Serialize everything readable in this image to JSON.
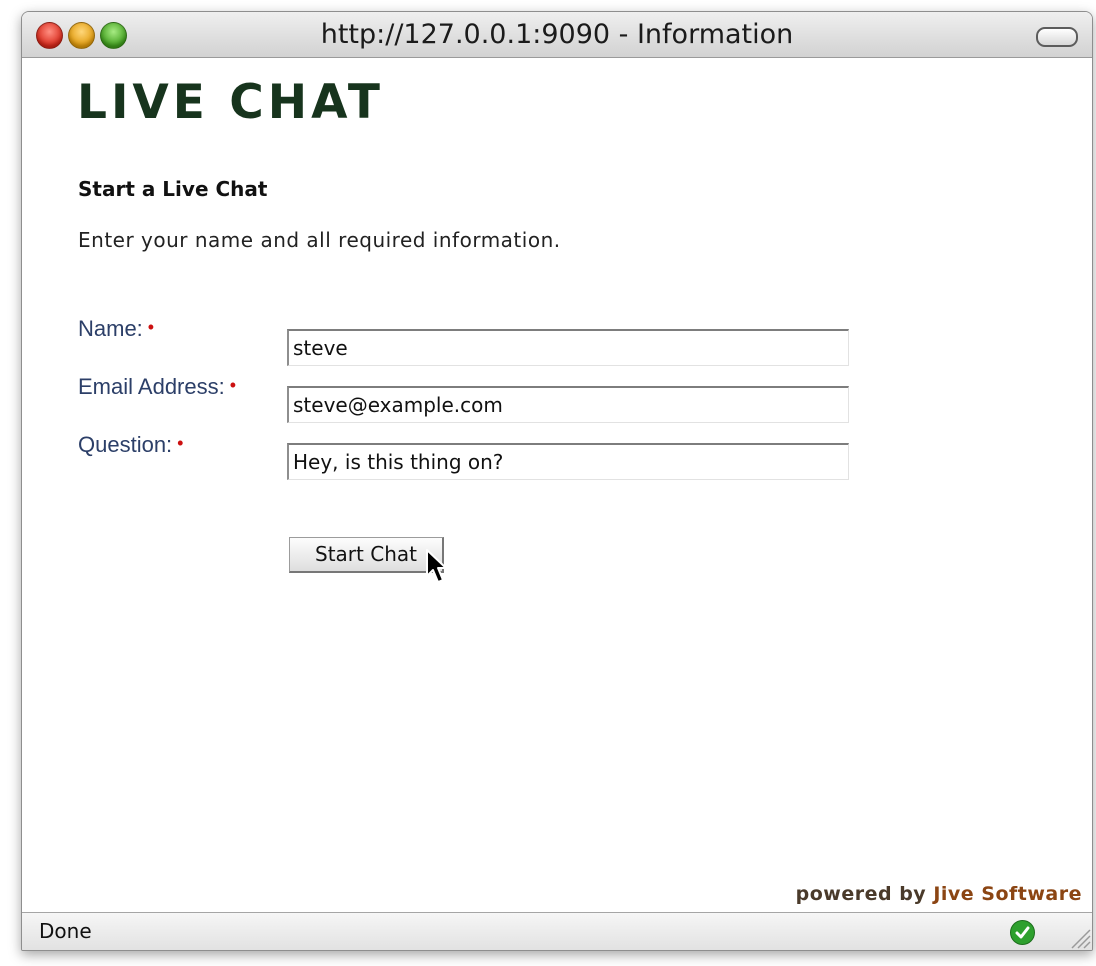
{
  "window": {
    "title": "http://127.0.0.1:9090 - Information"
  },
  "page": {
    "logo": "LIVE CHAT",
    "heading": "Start a Live Chat",
    "instruction": "Enter your name and all required information.",
    "required_marker": "•",
    "form": {
      "name_label": "Name:",
      "name_value": "steve",
      "email_label": "Email Address:",
      "email_value": "steve@example.com",
      "question_label": "Question:",
      "question_value": "Hey, is this thing on?",
      "submit_label": "Start Chat"
    },
    "powered_prefix": "powered by",
    "powered_brand": "Jive Software"
  },
  "statusbar": {
    "status": "Done"
  },
  "colors": {
    "logo": "#17341d",
    "label": "#2c3f68",
    "required": "#cc1010",
    "brand": "#8b4513"
  }
}
